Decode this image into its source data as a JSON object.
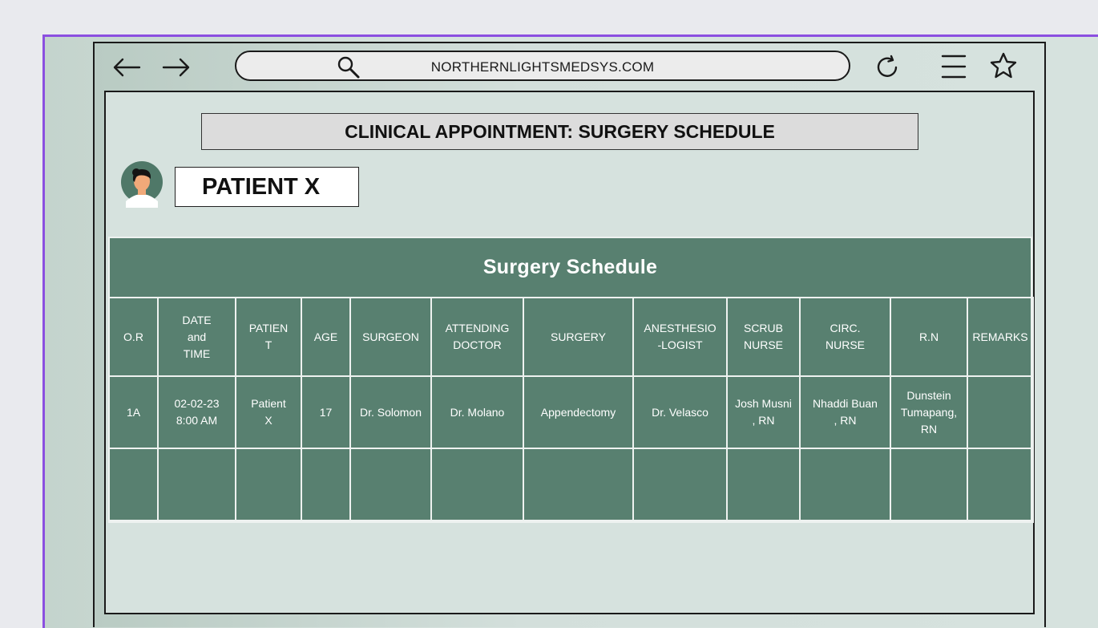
{
  "browser": {
    "url": "NORTHERNLIGHTSMEDSYS.COM",
    "icons": [
      "back-arrow-icon",
      "forward-arrow-icon",
      "search-icon",
      "refresh-icon",
      "menu-icon",
      "star-icon"
    ]
  },
  "page": {
    "title": "CLINICAL APPOINTMENT: SURGERY SCHEDULE",
    "patient_label": "PATIENT X"
  },
  "schedule": {
    "title": "Surgery Schedule",
    "columns": [
      "O.R",
      "DATE\nand\nTIME",
      "PATIEN\nT",
      "AGE",
      "SURGEON",
      "ATTENDING\nDOCTOR",
      "SURGERY",
      "ANESTHESIO\n-LOGIST",
      "SCRUB\nNURSE",
      "CIRC.\nNURSE",
      "R.N",
      "REMARKS"
    ],
    "rows": [
      [
        "1A",
        "02-02-23\n8:00 AM",
        "Patient\nX",
        "17",
        "Dr. Solomon",
        "Dr. Molano",
        "Appendectomy",
        "Dr. Velasco",
        "Josh Musni\n, RN",
        "Nhaddi Buan\n, RN",
        "Dunstein\nTumapang,\nRN",
        ""
      ],
      [
        "",
        "",
        "",
        "",
        "",
        "",
        "",
        "",
        "",
        "",
        "",
        ""
      ]
    ]
  },
  "colors": {
    "accent_border": "#8b4fe0",
    "table_green": "#588070",
    "background": "#d6e2de"
  }
}
